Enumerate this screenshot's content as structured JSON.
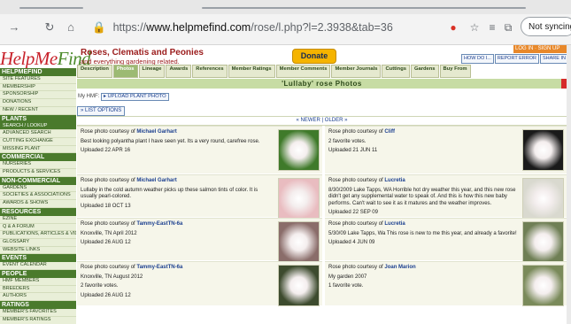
{
  "browser": {
    "url_prefix": "https://",
    "url_host": "www.helpmefind.com",
    "url_path": "/rose/l.php?l=2.3938&tab=36",
    "sync_label": "Not syncing"
  },
  "header": {
    "logo_a": "HelpMe",
    "logo_b": "Find",
    "site_title": "Roses, Clematis and Peonies",
    "site_subtitle": "and everything gardening related.",
    "donate_label": "Donate",
    "login_label": "LOG IN · SIGN UP",
    "links": [
      "HOW DO I...",
      "REPORT ERROR",
      "SHARE IN"
    ]
  },
  "sidebar": [
    {
      "type": "heading",
      "label": "HELPMEFIND"
    },
    {
      "type": "item",
      "label": "SITE FEATURES"
    },
    {
      "type": "item",
      "label": "MEMBERSHIP"
    },
    {
      "type": "item",
      "label": "SPONSORSHIP"
    },
    {
      "type": "item",
      "label": "DONATIONS"
    },
    {
      "type": "item",
      "label": "NEW / RECENT"
    },
    {
      "type": "heading",
      "label": "PLANTS"
    },
    {
      "type": "item",
      "label": "SEARCH / LOOKUP",
      "active": true
    },
    {
      "type": "item",
      "label": "ADVANCED SEARCH"
    },
    {
      "type": "item",
      "label": "CUTTING EXCHANGE"
    },
    {
      "type": "item",
      "label": "MISSING PLANT"
    },
    {
      "type": "heading",
      "label": "COMMERCIAL"
    },
    {
      "type": "item",
      "label": "NURSERIES"
    },
    {
      "type": "item",
      "label": "PRODUCTS & SERVICES"
    },
    {
      "type": "heading",
      "label": "NON-COMMERCIAL"
    },
    {
      "type": "item",
      "label": "GARDENS"
    },
    {
      "type": "item",
      "label": "SOCIETIES & ASSOCIATIONS"
    },
    {
      "type": "item",
      "label": "AWARDS & SHOWS"
    },
    {
      "type": "heading",
      "label": "RESOURCES"
    },
    {
      "type": "item",
      "label": "EZINE"
    },
    {
      "type": "item",
      "label": "Q & A FORUM"
    },
    {
      "type": "item",
      "label": "PUBLICATIONS, ARTICLES & VIDEOS"
    },
    {
      "type": "item",
      "label": "GLOSSARY"
    },
    {
      "type": "item",
      "label": "WEBSITE LINKS"
    },
    {
      "type": "heading",
      "label": "EVENTS"
    },
    {
      "type": "item",
      "label": "EVENT CALENDAR"
    },
    {
      "type": "heading",
      "label": "PEOPLE"
    },
    {
      "type": "item",
      "label": "HMF MEMBERS"
    },
    {
      "type": "item",
      "label": "BREEDERS"
    },
    {
      "type": "item",
      "label": "AUTHORS"
    },
    {
      "type": "heading",
      "label": "RATINGS"
    },
    {
      "type": "item",
      "label": "MEMBER'S FAVORITES"
    },
    {
      "type": "item",
      "label": "MEMBER'S RATINGS"
    }
  ],
  "tabs": [
    "Description",
    "Photos",
    "Lineage",
    "Awards",
    "References",
    "Member Ratings",
    "Member Comments",
    "Member Journals",
    "Cuttings",
    "Gardens",
    "Buy From"
  ],
  "active_tab": "Photos",
  "page_title": "'Lullaby' rose Photos",
  "my_hmf_label": "My HMF:",
  "upload_label": "UPLOAD PLANT PHOTO",
  "list_options_label": "LIST OPTIONS",
  "pager": "« NEWER | OLDER »",
  "photo_prefix": "Rose photo courtesy of",
  "uploaded_prefix": "Uploaded",
  "cards": [
    {
      "author": "Michael Garhart",
      "text": "Best looking polyantha plant I have seen yet. Its a very round, carefree rose.",
      "votes": "",
      "date": "22 APR 16",
      "photo_color": "#3f7a2a"
    },
    {
      "author": "Cliff",
      "text": "",
      "votes": "2 favorite votes.",
      "date": "21 JUN 11",
      "photo_color": "#1a1a1a"
    },
    {
      "author": "Michael Garhart",
      "text": "Lullaby in the cold autumn weather picks up these salmon tints of color. It is usually pearl-colored.",
      "votes": "",
      "date": "18 OCT 13",
      "photo_color": "#e9bcc0"
    },
    {
      "author": "Lucretia",
      "text": "8/30/2009 Lake Tapps, WA Horrible hot dry weather this year, and this new rose didn't get any supplemental water to speak of. And this is how this new baby performs. Can't wait to see it as it matures and the weather improves.",
      "votes": "",
      "date": "22 SEP 09",
      "photo_color": "#d9d9cf"
    },
    {
      "author": "Tammy-EastTN-6a",
      "text": "Knoxville, TN April 2012",
      "votes": "",
      "date": "26 AUG 12",
      "photo_color": "#8a6d6a"
    },
    {
      "author": "Lucretia",
      "text": "5/30/09 Lake Tapps, Wa This rose is new to me this year, and already a favorite!",
      "votes": "",
      "date": "4 JUN 09",
      "photo_color": "#6f7f55"
    },
    {
      "author": "Tammy-EastTN-6a",
      "text": "Knoxville, TN August 2012",
      "votes": "2 favorite votes.",
      "date": "26 AUG 12",
      "photo_color": "#3d4b2e"
    },
    {
      "author": "Joan Marion",
      "text": "My garden 2007",
      "votes": "1 favorite vote.",
      "date": "",
      "photo_color": "#7a8a5a"
    }
  ]
}
